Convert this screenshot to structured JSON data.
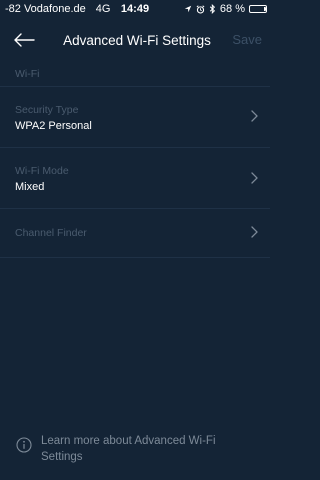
{
  "status_bar": {
    "carrier": "-82 Vodafone.de",
    "network": "4G",
    "time": "14:49",
    "battery_percent": "68 %",
    "battery_level": 0.68,
    "icons": [
      "location-arrow-icon",
      "alarm-icon",
      "bluetooth-icon",
      "battery-icon"
    ]
  },
  "nav": {
    "back_icon": "arrow-left-icon",
    "title": "Advanced Wi-Fi Settings",
    "save_label": "Save"
  },
  "section": {
    "header": "Wi-Fi"
  },
  "settings": [
    {
      "title": "Security Type",
      "value": "WPA2 Personal"
    },
    {
      "title": "Wi-Fi Mode",
      "value": "Mixed"
    },
    {
      "title": "Channel Finder",
      "value": ""
    }
  ],
  "footer": {
    "icon": "info-icon",
    "text": "Learn more about Advanced Wi-Fi Settings"
  },
  "colors": {
    "background": "#142436",
    "text_primary": "#ffffff",
    "text_muted": "#4a5b6e",
    "divider": "#1f3146",
    "save_disabled": "#3c5066"
  }
}
